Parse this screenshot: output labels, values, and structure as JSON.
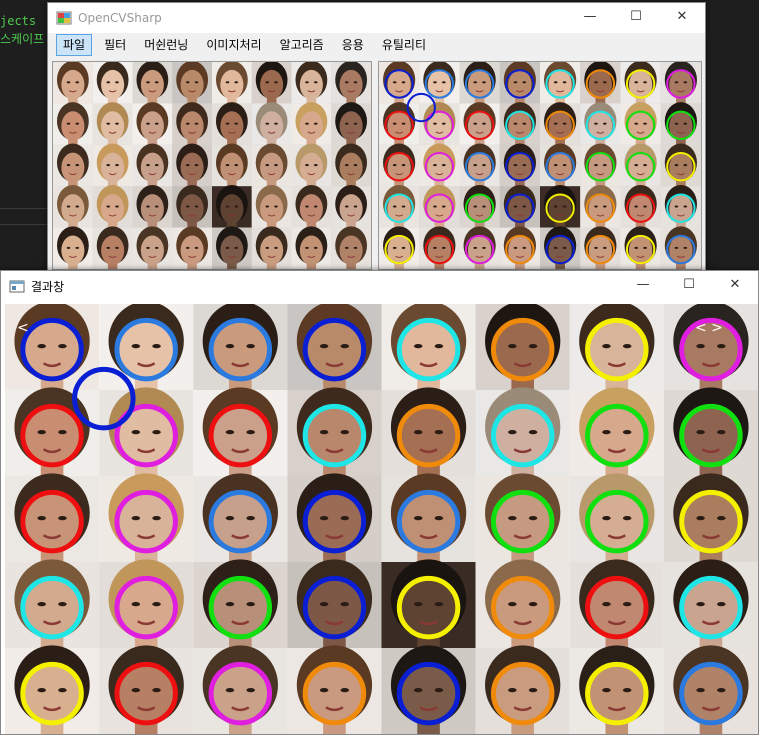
{
  "background": {
    "lines": [
      "jects",
      "스케이프"
    ]
  },
  "main_window": {
    "title": "OpenCVSharp",
    "controls": {
      "minimize": "—",
      "maximize": "☐",
      "close": "✕"
    },
    "menu": [
      "파일",
      "필터",
      "머쉰런닝",
      "이미지처리",
      "알고리즘",
      "응용",
      "유틸리티"
    ],
    "active_menu_index": 0
  },
  "result_window": {
    "title": "결과창",
    "controls": {
      "minimize": "—",
      "maximize": "☐",
      "close": "✕"
    }
  },
  "face_grid": {
    "rows": 5,
    "cols": 8,
    "skin_tones": [
      [
        "#d6a98c",
        "#e5c2a8",
        "#c99a7c",
        "#b98a6a",
        "#e2b89c",
        "#9b6a4e",
        "#d8b49a",
        "#a97a62"
      ],
      [
        "#c98e72",
        "#e0bca2",
        "#caa08a",
        "#b9876c",
        "#a46f52",
        "#cfb0a0",
        "#d7a98c",
        "#8e6450"
      ],
      [
        "#c89478",
        "#d9b29a",
        "#c6a08a",
        "#9a6c56",
        "#c09074",
        "#c59a80",
        "#d5ad92",
        "#a97d5e"
      ],
      [
        "#d2aa8e",
        "#d8a88c",
        "#b8907a",
        "#7e5846",
        "#5e4232",
        "#c99a7e",
        "#c08870",
        "#c9a48e"
      ],
      [
        "#d8b090",
        "#b77f63",
        "#caa28a",
        "#c99a80",
        "#7a5a48",
        "#c99c80",
        "#c29274",
        "#b08268"
      ]
    ],
    "backgrounds": [
      [
        "#efe8e2",
        "#f3efec",
        "#dcd8d4",
        "#c9c5c2",
        "#f0ece8",
        "#d9d2cc",
        "#ecebea",
        "#e6e2df"
      ],
      [
        "#f0eeea",
        "#e8e4e0",
        "#f2efec",
        "#d8d1cb",
        "#e4dfda",
        "#eae8e7",
        "#f0ebe6",
        "#ded9d4"
      ],
      [
        "#ebe7e2",
        "#efe9e4",
        "#eae6e3",
        "#d5cec8",
        "#e6e2de",
        "#ece6e0",
        "#e8e5e2",
        "#dfd9d4"
      ],
      [
        "#e9e4df",
        "#e2ddd8",
        "#dcd5cf",
        "#c7c1bc",
        "#3a2c24",
        "#ebe6e1",
        "#e5e0db",
        "#e6e2de"
      ],
      [
        "#f1ece8",
        "#e8e3de",
        "#e9e5e1",
        "#ece7e2",
        "#cfc9c4",
        "#e4dfdb",
        "#ece8e4",
        "#e7e2dd"
      ]
    ],
    "hair": [
      [
        "#5a3a22",
        "#3a2a1e",
        "#2a1e16",
        "#5c3a24",
        "#6a4a30",
        "#1e1610",
        "#3c2a1c",
        "#2a2420"
      ],
      [
        "#4a3424",
        "#b08a52",
        "#5a3a22",
        "#3e2a1c",
        "#2a1e16",
        "#9a8a78",
        "#c8a060",
        "#1e1814"
      ],
      [
        "#3c2a1e",
        "#c89a5c",
        "#4a3222",
        "#2a1e16",
        "#5a3a22",
        "#6a4a30",
        "#b89a6a",
        "#3a2a1e"
      ],
      [
        "#7a5a3a",
        "#c0965a",
        "#2c2018",
        "#3a2a1e",
        "#1a1410",
        "#8a6a4a",
        "#3a2a1e",
        "#2a1e16"
      ],
      [
        "#2a1e16",
        "#3a2a1e",
        "#4a3424",
        "#5a3a22",
        "#1e1814",
        "#3a2a1e",
        "#2a2018",
        "#4a3424"
      ]
    ],
    "circle_colors": [
      [
        "blue",
        "dodgerblue",
        "dodgerblue",
        "blue",
        "cyan",
        "orange",
        "yellow",
        "magenta"
      ],
      [
        "red",
        "magenta",
        "red",
        "cyan",
        "orange",
        "cyan",
        "lime",
        "lime"
      ],
      [
        "red",
        "magenta",
        "dodgerblue",
        "blue",
        "dodgerblue",
        "lime",
        "lime",
        "yellow"
      ],
      [
        "cyan",
        "magenta",
        "lime",
        "blue",
        "yellow",
        "orange",
        "red",
        "cyan"
      ],
      [
        "yellow",
        "red",
        "magenta",
        "orange",
        "blue",
        "orange",
        "yellow",
        "dodgerblue"
      ]
    ],
    "extra_circle": {
      "color": "blue",
      "row": 0,
      "col": 0
    },
    "nav_arrows": {
      "left": "<",
      "right": "< >"
    }
  },
  "colors": {
    "blue": "#0a1ed4",
    "dodgerblue": "#2a7ae0",
    "cyan": "#1ee6e6",
    "orange": "#f08a0a",
    "yellow": "#f5f000",
    "magenta": "#e01ee0",
    "red": "#ee1010",
    "lime": "#10e010"
  }
}
